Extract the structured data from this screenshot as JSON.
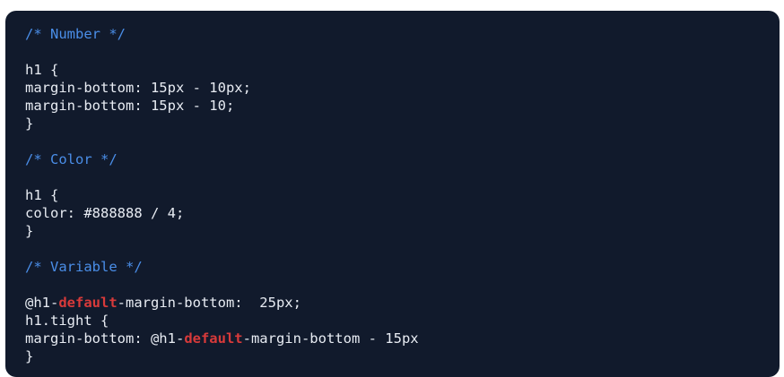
{
  "code": {
    "lines": [
      [
        {
          "t": "/* Number */",
          "c": "comment"
        }
      ],
      [],
      [
        {
          "t": "h1 {",
          "c": "plain"
        }
      ],
      [
        {
          "t": "margin-bottom: 15px - 10px;",
          "c": "plain"
        }
      ],
      [
        {
          "t": "margin-bottom: 15px - 10;",
          "c": "plain"
        }
      ],
      [
        {
          "t": "}",
          "c": "plain"
        }
      ],
      [],
      [
        {
          "t": "/* Color */",
          "c": "comment"
        }
      ],
      [],
      [
        {
          "t": "h1 {",
          "c": "plain"
        }
      ],
      [
        {
          "t": "color: #888888 / 4;",
          "c": "plain"
        }
      ],
      [
        {
          "t": "}",
          "c": "plain"
        }
      ],
      [],
      [
        {
          "t": "/* Variable */",
          "c": "comment"
        }
      ],
      [],
      [
        {
          "t": "@h1-",
          "c": "plain"
        },
        {
          "t": "default",
          "c": "keyword"
        },
        {
          "t": "-margin-bottom:  25px;",
          "c": "plain"
        }
      ],
      [
        {
          "t": "h1.tight {",
          "c": "plain"
        }
      ],
      [
        {
          "t": "margin-bottom: @h1-",
          "c": "plain"
        },
        {
          "t": "default",
          "c": "keyword"
        },
        {
          "t": "-margin-bottom - 15px",
          "c": "plain"
        }
      ],
      [
        {
          "t": "}",
          "c": "plain"
        }
      ]
    ]
  },
  "colors": {
    "panel_background": "#111a2c",
    "comment": "#4a8ee8",
    "keyword": "#d83a3a",
    "text": "#e8ecf3"
  }
}
